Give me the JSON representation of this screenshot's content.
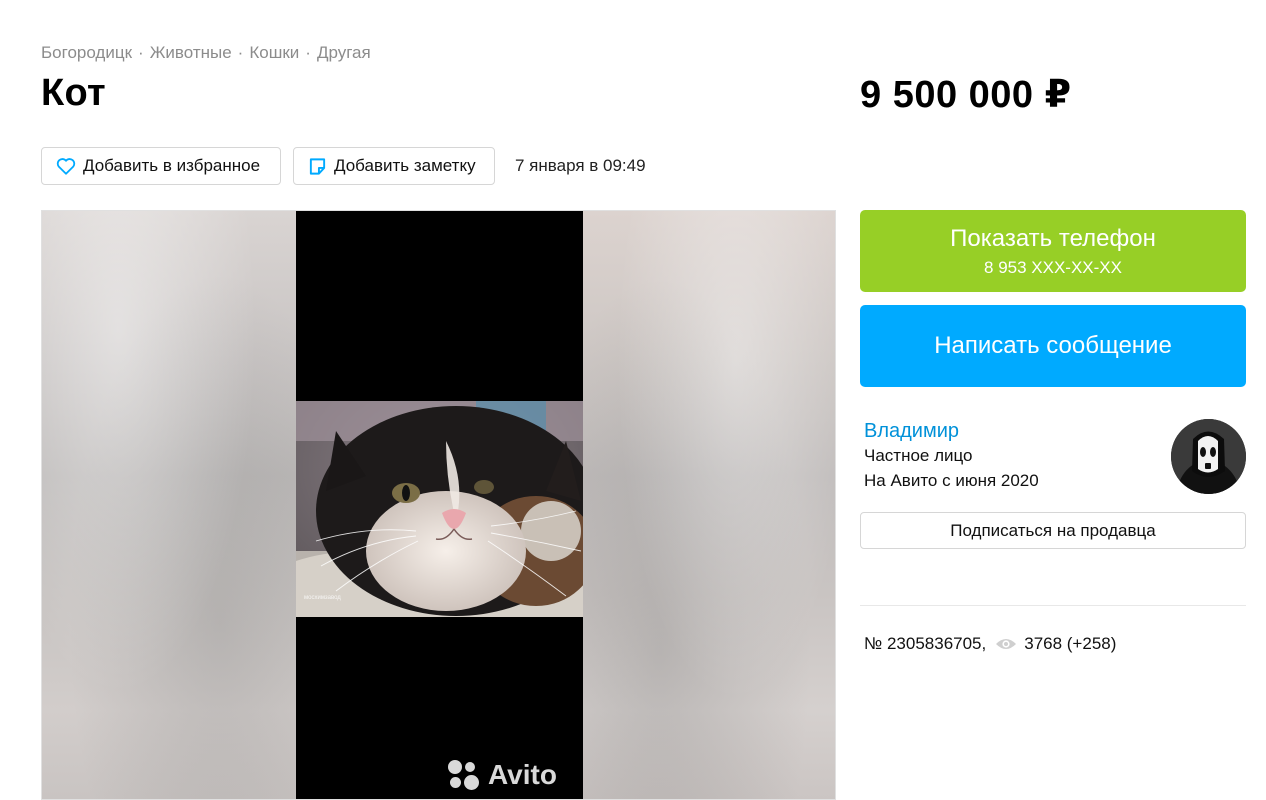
{
  "breadcrumbs": [
    "Богородицк",
    "Животные",
    "Кошки",
    "Другая"
  ],
  "breadcrumb_separator": "·",
  "listing": {
    "title": "Кот",
    "price": "9 500 000 ₽",
    "date": "7 января в 09:49",
    "number": "№ 2305836705,",
    "views": "3768 (+258)"
  },
  "actions": {
    "favorite_label": "Добавить в избранное",
    "note_label": "Добавить заметку"
  },
  "contact": {
    "show_phone_label": "Показать телефон",
    "phone_masked": "8 953 XXX-XX-XX",
    "message_label": "Написать сообщение",
    "subscribe_label": "Подписаться на продавца"
  },
  "seller": {
    "name": "Владимир",
    "type": "Частное лицо",
    "since": "На Авито с июня 2020"
  },
  "gallery": {
    "watermark": "Avito"
  },
  "icons": {
    "favorite": "heart-icon",
    "note": "note-icon",
    "views": "eye-icon"
  },
  "colors": {
    "phone_button": "#97cf26",
    "message_button": "#00aaff",
    "seller_link": "#0091d9",
    "breadcrumb": "#8c8c8c",
    "favorite_icon": "#00aaff",
    "note_icon": "#00aaff"
  }
}
